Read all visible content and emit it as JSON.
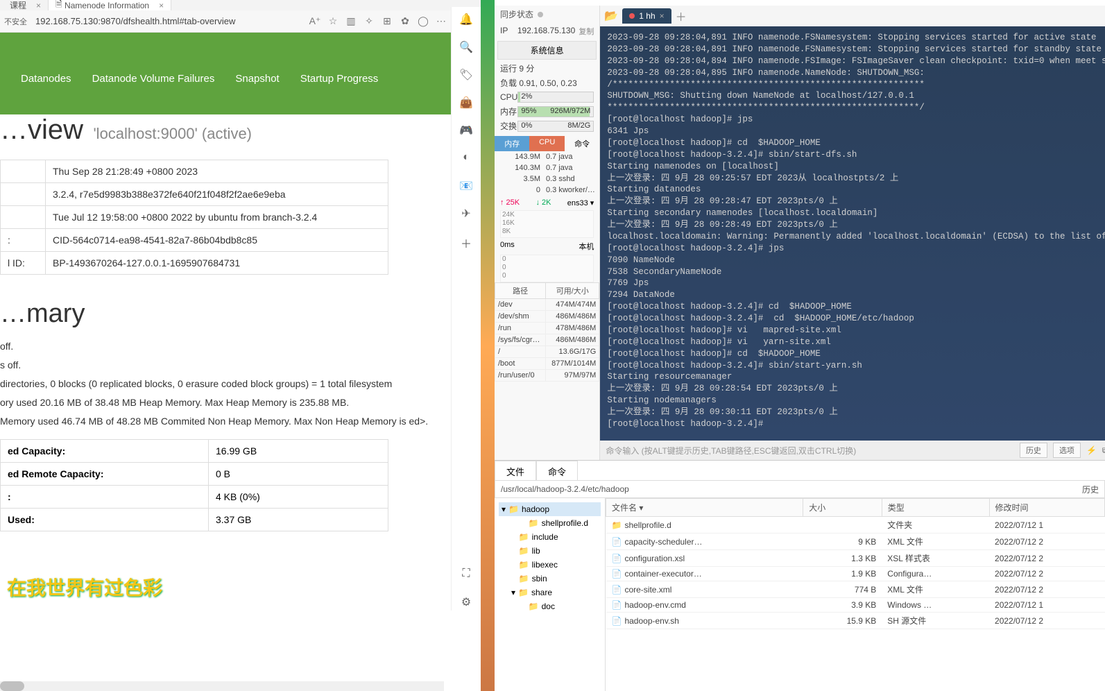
{
  "browser": {
    "tabs": [
      "课程",
      "Namenode Information"
    ],
    "url": "192.168.75.130:9870/dfshealth.html#tab-overview",
    "security": "不安全",
    "nav": [
      "Datanodes",
      "Datanode Volume Failures",
      "Snapshot",
      "Startup Progress"
    ],
    "ov_title": "…view",
    "ov_sub": "'localhost:9000' (active)",
    "table": [
      [
        "",
        "Thu Sep 28 21:28:49 +0800 2023"
      ],
      [
        "",
        "3.2.4, r7e5d9983b388e372fe640f21f048f2f2ae6e9eba"
      ],
      [
        "",
        "Tue Jul 12 19:58:00 +0800 2022 by ubuntu from branch-3.2.4"
      ],
      [
        ":",
        "CID-564c0714-ea98-4541-82a7-86b04bdb8c85"
      ],
      [
        "l ID:",
        "BP-1493670264-127.0.0.1-1695907684731"
      ]
    ],
    "summary_h": "…mary",
    "summary_lines": [
      "off.",
      "s off.",
      "directories, 0 blocks (0 replicated blocks, 0 erasure coded block groups) = 1 total filesystem",
      "ory used 20.16 MB of 38.48 MB Heap Memory. Max Heap Memory is 235.88 MB.",
      "Memory used 46.74 MB of 48.28 MB Commited Non Heap Memory. Max Non Heap Memory is ed>."
    ],
    "cap": [
      [
        "ed Capacity:",
        "16.99 GB"
      ],
      [
        "ed Remote Capacity:",
        "0 B"
      ],
      [
        ":",
        "4 KB (0%)"
      ],
      [
        "Used:",
        "3.37 GB"
      ]
    ],
    "overlay": "在我世界有过色彩"
  },
  "fs": {
    "sync": "同步状态",
    "ip_label": "IP",
    "ip": "192.168.75.130",
    "copy": "复制",
    "sysinfo_btn": "系统信息",
    "uptime": "运行 9 分",
    "load": "负载 0.91, 0.50, 0.23",
    "cpu_l": "CPU",
    "cpu_v": "2%",
    "mem_l": "内存",
    "mem_v": "95%",
    "mem_r": "926M/972M",
    "swp_l": "交换",
    "swp_v": "0%",
    "swp_r": "8M/2G",
    "ptabs": [
      "内存",
      "CPU",
      "命令"
    ],
    "procs": [
      [
        "143.9M",
        "0.7 java"
      ],
      [
        "140.3M",
        "0.7 java"
      ],
      [
        "3.5M",
        "0.3 sshd"
      ],
      [
        "0",
        "0.3 kworker/…"
      ]
    ],
    "net_up": "↑ 25K",
    "net_dn": "↓ 2K",
    "net_if": "ens33 ▾",
    "chart_y": [
      "24K",
      "16K",
      "8K"
    ],
    "net_ms": "0ms",
    "net_host": "本机",
    "disk_h": [
      "路径",
      "可用/大小"
    ],
    "disks": [
      [
        "/dev",
        "474M/474M"
      ],
      [
        "/dev/shm",
        "486M/486M"
      ],
      [
        "/run",
        "478M/486M"
      ],
      [
        "/sys/fs/cgr…",
        "486M/486M"
      ],
      [
        "/",
        "13.6G/17G"
      ],
      [
        "/boot",
        "877M/1014M"
      ],
      [
        "/run/user/0",
        "97M/97M"
      ]
    ],
    "term_tab": "1 hh",
    "term_lines": [
      "2023-09-28 09:28:04,891 INFO namenode.FSNamesystem: Stopping services started for active state",
      "2023-09-28 09:28:04,891 INFO namenode.FSNamesystem: Stopping services started for standby state",
      "2023-09-28 09:28:04,894 INFO namenode.FSImage: FSImageSaver clean checkpoint: txid=0 when meet s",
      "2023-09-28 09:28:04,895 INFO namenode.NameNode: SHUTDOWN_MSG:",
      "/************************************************************",
      "SHUTDOWN_MSG: Shutting down NameNode at localhost/127.0.0.1",
      "************************************************************/",
      "[root@localhost hadoop]# jps",
      "6341 Jps",
      "[root@localhost hadoop]# cd  $HADOOP_HOME",
      "[root@localhost hadoop-3.2.4]# sbin/start-dfs.sh",
      "Starting namenodes on [localhost]",
      "上一次登录: 四 9月 28 09:25:57 EDT 2023从 localhostpts/2 上",
      "Starting datanodes",
      "上一次登录: 四 9月 28 09:28:47 EDT 2023pts/0 上",
      "Starting secondary namenodes [localhost.localdomain]",
      "上一次登录: 四 9月 28 09:28:49 EDT 2023pts/0 上",
      "localhost.localdomain: Warning: Permanently added 'localhost.localdomain' (ECDSA) to the list of",
      "[root@localhost hadoop-3.2.4]# jps",
      "7090 NameNode",
      "7538 SecondaryNameNode",
      "7769 Jps",
      "7294 DataNode",
      "[root@localhost hadoop-3.2.4]# cd  $HADOOP_HOME",
      "[root@localhost hadoop-3.2.4]#  cd  $HADOOP_HOME/etc/hadoop",
      "[root@localhost hadoop]# vi   mapred-site.xml",
      "[root@localhost hadoop]# vi   yarn-site.xml",
      "[root@localhost hadoop]# cd  $HADOOP_HOME",
      "[root@localhost hadoop-3.2.4]# sbin/start-yarn.sh",
      "Starting resourcemanager",
      "上一次登录: 四 9月 28 09:28:54 EDT 2023pts/0 上",
      "Starting nodemanagers",
      "上一次登录: 四 9月 28 09:30:11 EDT 2023pts/0 上",
      "[root@localhost hadoop-3.2.4]# "
    ],
    "cmd_hint": "命令输入 (按ALT键提示历史,TAB键路径,ESC键返回,双击CTRL切换)",
    "cmd_btns": [
      "历史",
      "选项"
    ],
    "fb_tabs": [
      "文件",
      "命令"
    ],
    "fb_path": "/usr/local/hadoop-3.2.4/etc/hadoop",
    "fb_hist": "历史",
    "tree": [
      {
        "n": "hadoop",
        "lv": 0,
        "exp": true,
        "sel": true
      },
      {
        "n": "shellprofile.d",
        "lv": 2
      },
      {
        "n": "include",
        "lv": 1
      },
      {
        "n": "lib",
        "lv": 1
      },
      {
        "n": "libexec",
        "lv": 1
      },
      {
        "n": "sbin",
        "lv": 1
      },
      {
        "n": "share",
        "lv": 1,
        "exp": true
      },
      {
        "n": "doc",
        "lv": 2
      }
    ],
    "cols": [
      "文件名 ▾",
      "大小",
      "类型",
      "修改时间"
    ],
    "files": [
      {
        "n": "shellprofile.d",
        "s": "",
        "t": "文件夹",
        "m": "2022/07/12 1",
        "dir": true
      },
      {
        "n": "capacity-scheduler…",
        "s": "9 KB",
        "t": "XML 文件",
        "m": "2022/07/12 2"
      },
      {
        "n": "configuration.xsl",
        "s": "1.3 KB",
        "t": "XSL 样式表",
        "m": "2022/07/12 2"
      },
      {
        "n": "container-executor…",
        "s": "1.9 KB",
        "t": "Configura…",
        "m": "2022/07/12 2"
      },
      {
        "n": "core-site.xml",
        "s": "774 B",
        "t": "XML 文件",
        "m": "2022/07/12 2"
      },
      {
        "n": "hadoop-env.cmd",
        "s": "3.9 KB",
        "t": "Windows …",
        "m": "2022/07/12 1"
      },
      {
        "n": "hadoop-env.sh",
        "s": "15.9 KB",
        "t": "SH 源文件",
        "m": "2022/07/12 2"
      }
    ]
  }
}
